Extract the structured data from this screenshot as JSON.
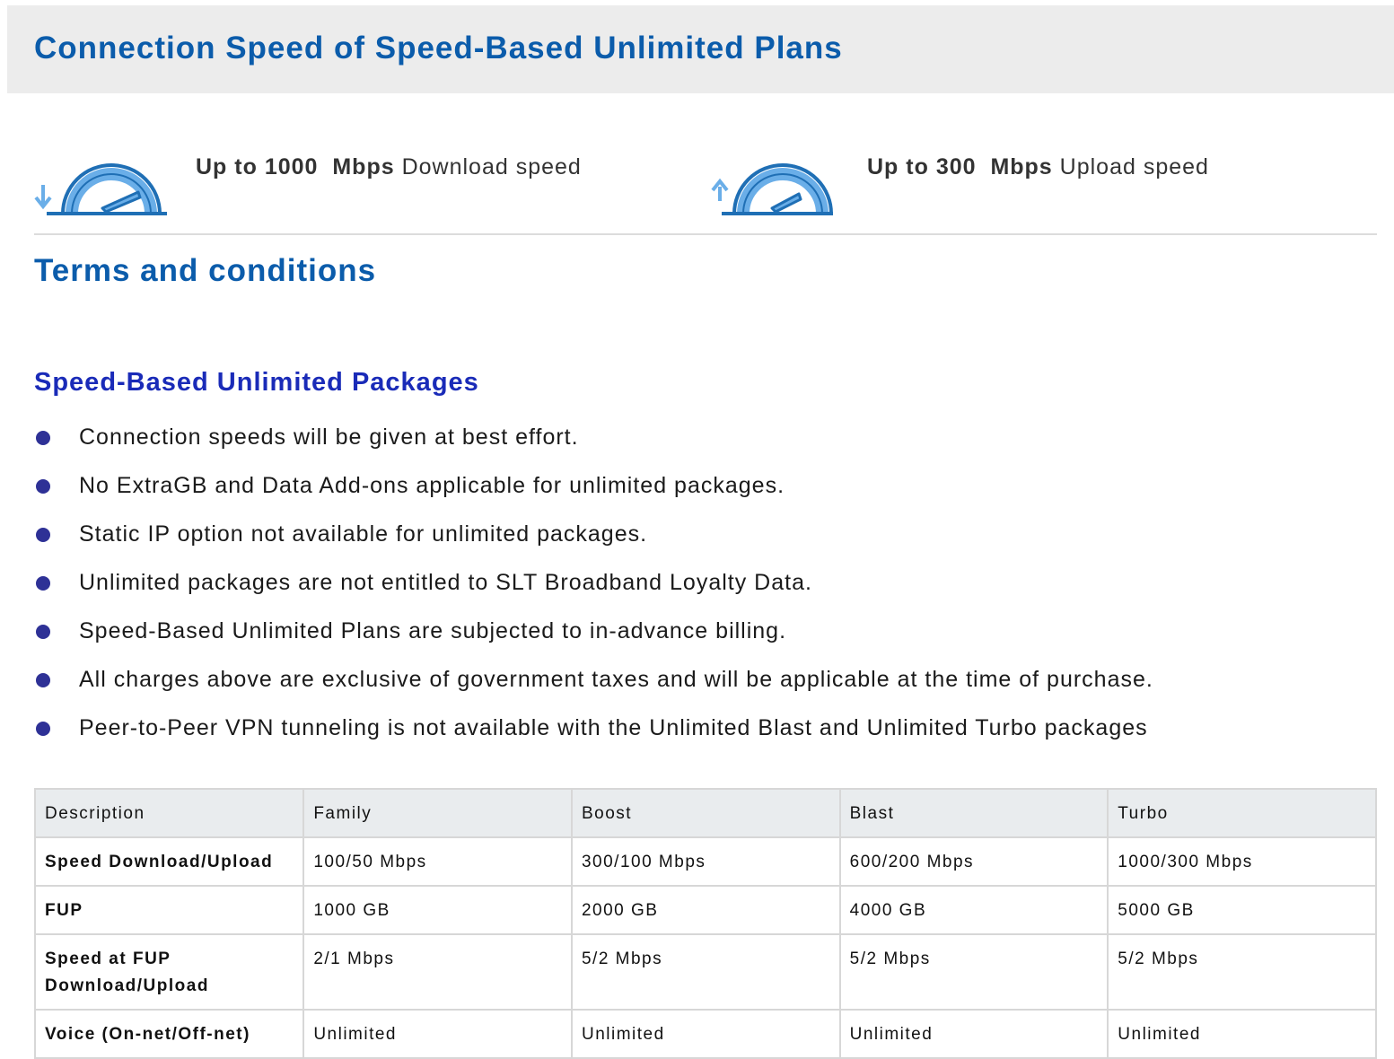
{
  "header": {
    "title": "Connection Speed of Speed-Based Unlimited Plans"
  },
  "speeds": {
    "download": {
      "prefix": "Up to 1000",
      "unit": "Mbps",
      "suffix": "Download speed",
      "icon": "download-speed-gauge-icon"
    },
    "upload": {
      "prefix": "Up to 300",
      "unit": "Mbps",
      "suffix": "Upload speed",
      "icon": "upload-speed-gauge-icon"
    }
  },
  "terms": {
    "title": "Terms and conditions",
    "section_title": "Speed-Based Unlimited Packages",
    "bullets": [
      "Connection speeds will be given at best effort.",
      "No ExtraGB and Data Add-ons applicable for unlimited packages.",
      "Static IP option not available for unlimited packages.",
      "Unlimited packages are not entitled to SLT Broadband Loyalty Data.",
      "Speed-Based Unlimited Plans are subjected to in-advance billing.",
      "All charges above are exclusive of government taxes and will be applicable at the time of purchase.",
      "Peer-to-Peer VPN tunneling is not available with the Unlimited Blast and Unlimited Turbo packages"
    ]
  },
  "table": {
    "headers": [
      "Description",
      "Family",
      "Boost",
      "Blast",
      "Turbo"
    ],
    "rows": [
      {
        "label": "Speed Download/Upload",
        "cells": [
          "100/50 Mbps",
          "300/100 Mbps",
          "600/200 Mbps",
          "1000/300 Mbps"
        ]
      },
      {
        "label": "FUP",
        "cells": [
          "1000 GB",
          "2000 GB",
          "4000 GB",
          "5000 GB"
        ]
      },
      {
        "label": "Speed at FUP Download/Upload",
        "cells": [
          "2/1 Mbps",
          "5/2 Mbps",
          "5/2 Mbps",
          "5/2 Mbps"
        ]
      },
      {
        "label": "Voice (On-net/Off-net)",
        "cells": [
          "Unlimited",
          "Unlimited",
          "Unlimited",
          "Unlimited"
        ]
      }
    ]
  },
  "colors": {
    "heading_blue": "#0b5cab",
    "section_blue": "#1a2bb8",
    "bullet_dot": "#2e3196",
    "gauge_light": "#6aaee8",
    "gauge_dark": "#1f6fb5",
    "header_band": "#ececec"
  }
}
